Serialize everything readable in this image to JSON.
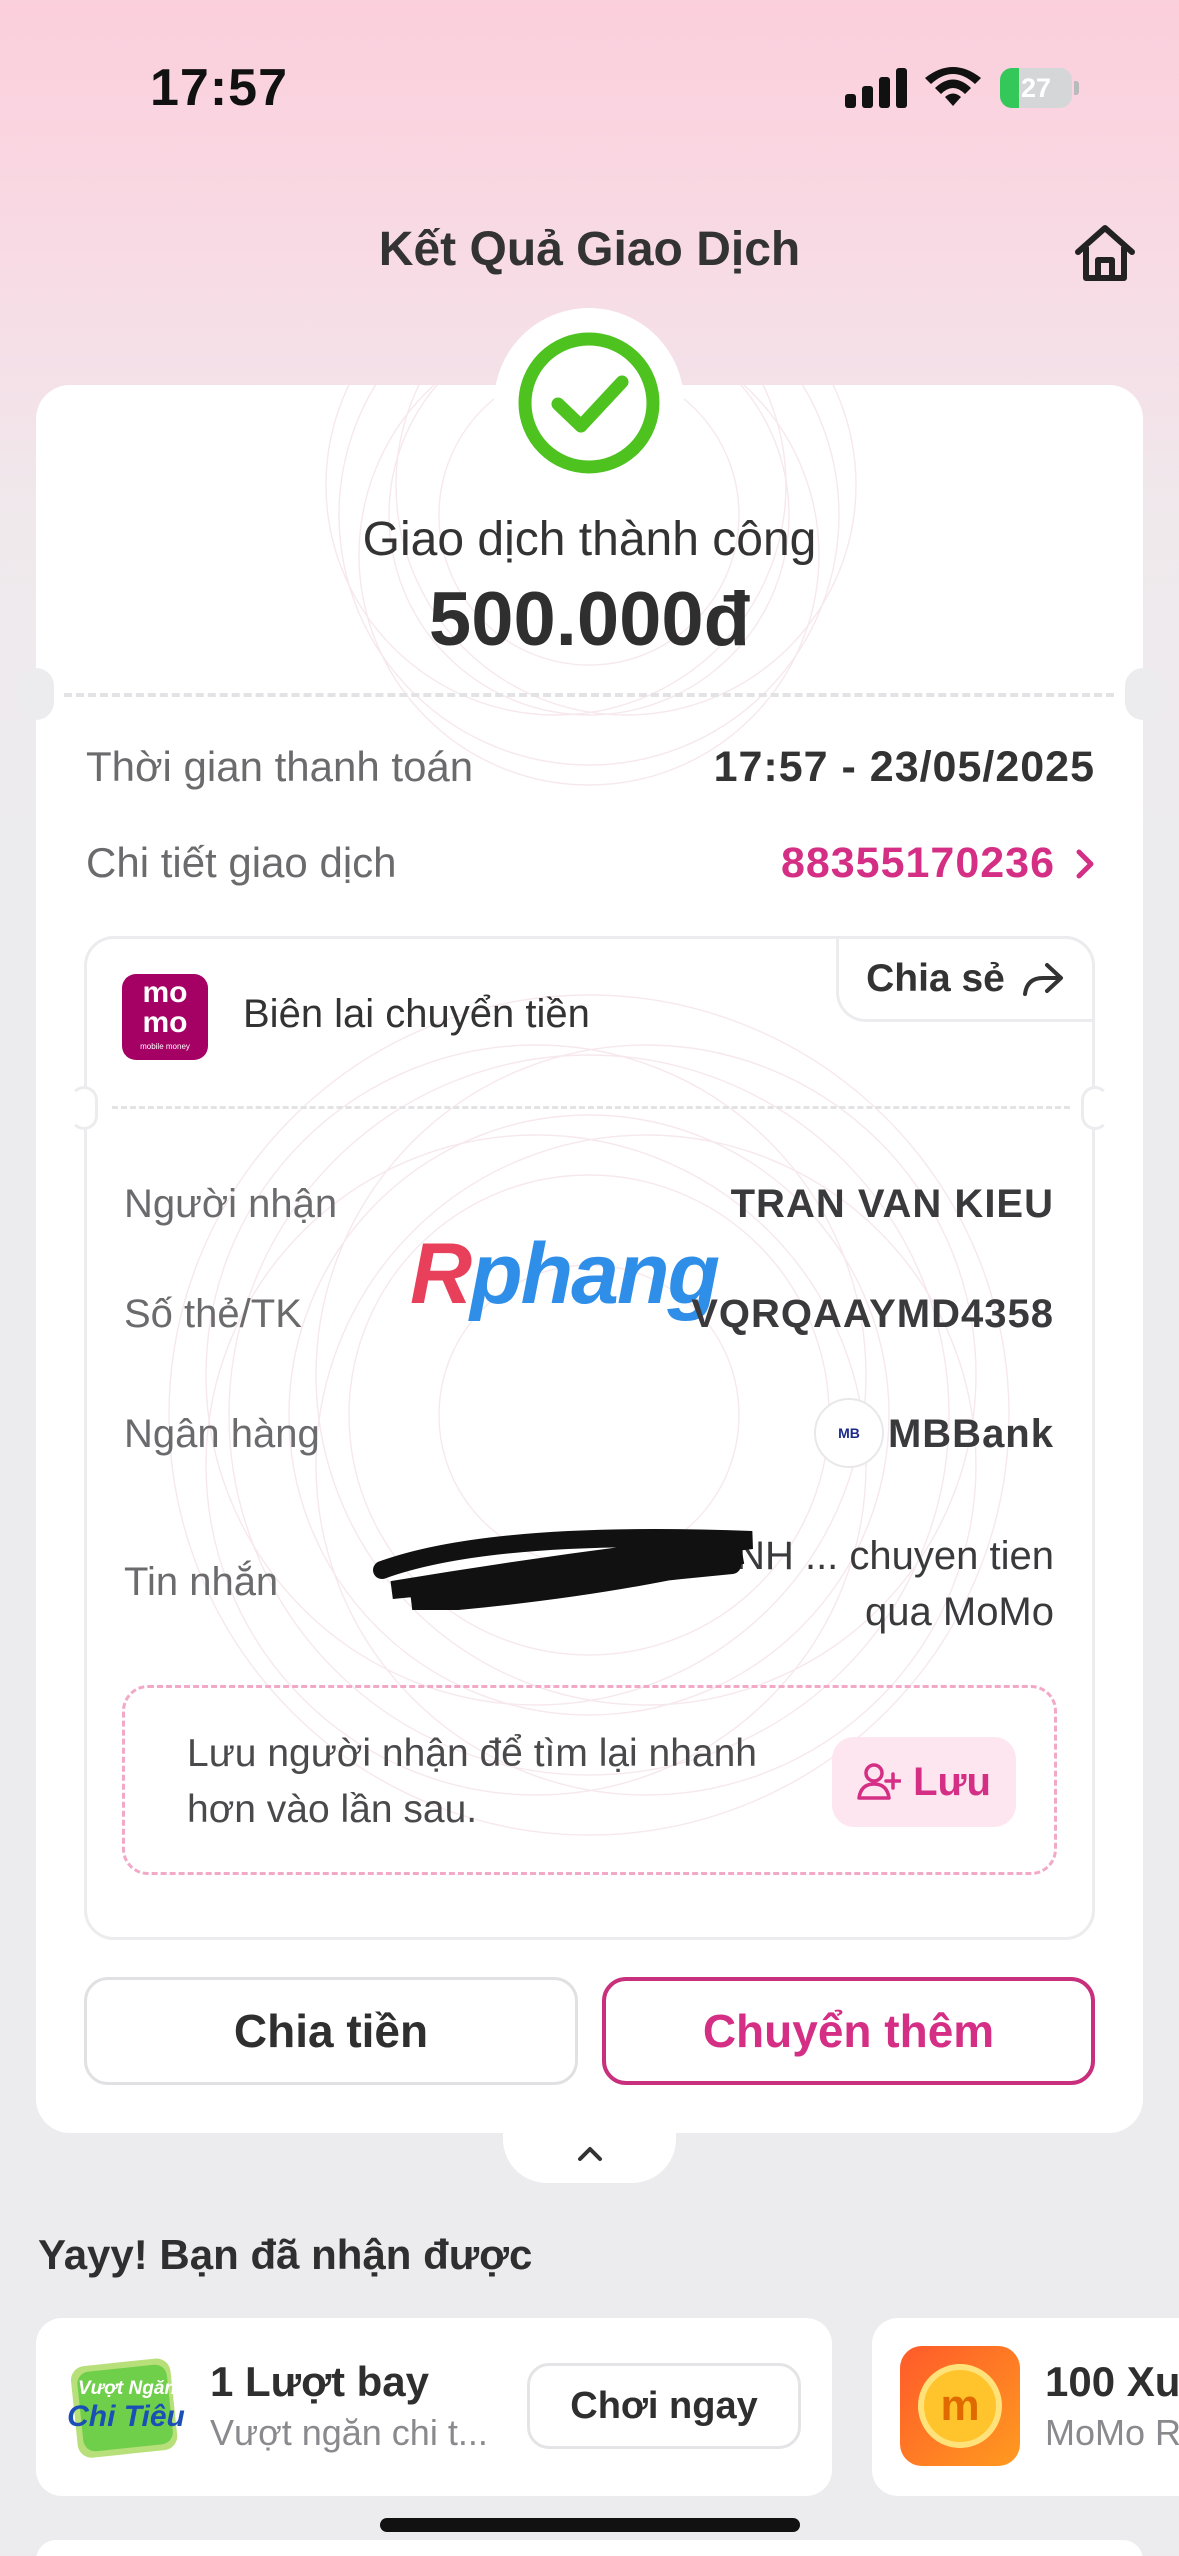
{
  "status_bar": {
    "time": "17:57",
    "battery": "27",
    "battery_level": 0.27
  },
  "header": {
    "title": "Kết Quả Giao Dịch"
  },
  "result": {
    "status": "Giao dịch thành công",
    "amount": "500.000đ"
  },
  "info": {
    "time_label": "Thời gian thanh toán",
    "time_value": "17:57 - 23/05/2025",
    "detail_label": "Chi tiết giao dịch",
    "detail_value": "88355170236"
  },
  "receipt": {
    "logo_line1": "mo",
    "logo_line2": "mo",
    "logo_line3": "mobile money",
    "title": "Biên lai chuyển tiền",
    "share_label": "Chia sẻ",
    "rows": [
      {
        "label": "Người nhận",
        "value": "TRAN VAN KIEU"
      },
      {
        "label": "Số thẻ/TK",
        "value": "VQRQAAYMD4358"
      },
      {
        "label": "Ngân hàng",
        "value": "MBBank"
      },
      {
        "label": "Tin nhắn",
        "value": "THANH ... chuyen tien qua MoMo"
      }
    ],
    "bank_logo_text": "MB",
    "save_hint": "Lưu người nhận để tìm lại nhanh hơn vào lần sau.",
    "save_button": "Lưu"
  },
  "watermark": {
    "part1": "R",
    "part2": "phang"
  },
  "actions": {
    "split": "Chia tiền",
    "transfer_more": "Chuyển thêm"
  },
  "rewards": {
    "title": "Yayy! Bạn đã nhận được",
    "items": [
      {
        "title": "1 Lượt bay",
        "subtitle": "Vượt ngăn chi t...",
        "button": "Chơi ngay",
        "icon_text_1": "Vượt Ngăn",
        "icon_text_2": "Chi Tiêu"
      },
      {
        "title": "100 Xu",
        "subtitle": "MoMo R",
        "icon_text": "m"
      }
    ]
  }
}
